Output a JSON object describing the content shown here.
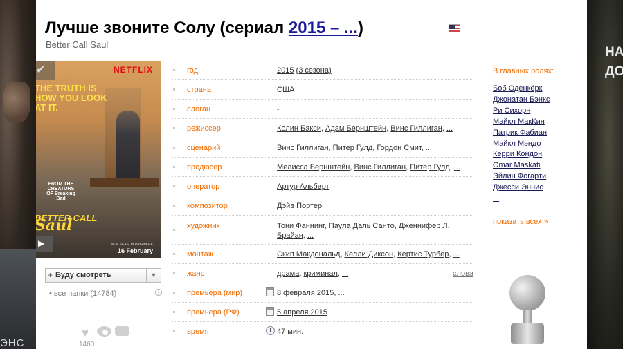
{
  "title": {
    "text": "Лучше звоните Солу (сериал ",
    "years_link": "2015 – ...",
    "close": ")",
    "original": "Better Call Saul"
  },
  "poster": {
    "brand": "NETFLIX",
    "tagline": "THE TRUTH IS HOW YOU LOOK AT IT.",
    "credit": "FROM THE CREATORS OF Breaking Bad",
    "logo_line1": "BETTER CALL",
    "logo_line2": "Saul",
    "premiere_small": "NEW SEASON PREMIERE",
    "premiere": "16 February"
  },
  "folder": {
    "label": "Буду смотреть",
    "all_folders": "все папки (14784)"
  },
  "social": {
    "count": "1460"
  },
  "info": {
    "year": {
      "label": "год",
      "value": "2015",
      "extra": "(3 сезона)"
    },
    "country": {
      "label": "страна",
      "value": "США"
    },
    "slogan": {
      "label": "слоган",
      "value": "-"
    },
    "director": {
      "label": "режиссер",
      "values": [
        "Колин Бакси",
        "Адам Бернштейн",
        "Винс Гиллиган"
      ],
      "more": "..."
    },
    "writer": {
      "label": "сценарий",
      "values": [
        "Винс Гиллиган",
        "Питер Гулд",
        "Гордон Смит"
      ],
      "more": "..."
    },
    "producer": {
      "label": "продюсер",
      "values": [
        "Мелисса Бернштейн",
        "Винс Гиллиган",
        "Питер Гулд"
      ],
      "more": "..."
    },
    "operator": {
      "label": "оператор",
      "value": "Артур Альберт"
    },
    "composer": {
      "label": "композитор",
      "value": "Дэйв Портер"
    },
    "artist": {
      "label": "художник",
      "values": [
        "Тони Фаннинг",
        "Паула Даль Санто",
        "Дженнифер Л. Брайан"
      ],
      "more": "..."
    },
    "editing": {
      "label": "монтаж",
      "values": [
        "Скип Макдональд",
        "Келли Диксон",
        "Кертис Турбер"
      ],
      "more": "..."
    },
    "genre": {
      "label": "жанр",
      "values": [
        "драма",
        "криминал"
      ],
      "more": "...",
      "aside": "слова"
    },
    "premiere_world": {
      "label": "премьера (мир)",
      "value": "8 февраля 2015",
      "more": "..."
    },
    "premiere_rf": {
      "label": "премьера (РФ)",
      "value": "5 апреля 2015"
    },
    "runtime": {
      "label": "время",
      "value": "47 мин."
    }
  },
  "cast": {
    "heading": "В главных ролях:",
    "names": [
      "Боб Оденкёрк",
      "Джонатан Бэнкс",
      "Ри Сихорн",
      "Майкл МакКин",
      "Патрик Фабиан",
      "Майкл Мэндо",
      "Керри Кондон",
      "Omar Maskati",
      "Эйлин Фогарти",
      "Джесси Эннис",
      "..."
    ],
    "show_all": "показать всех »"
  },
  "backdrop": {
    "left_text": "ЭНС",
    "right_line1": "НА",
    "right_line2": "ДО"
  },
  "colors": {
    "label_orange": "#f26b00",
    "link_blue": "#1a1a99"
  }
}
